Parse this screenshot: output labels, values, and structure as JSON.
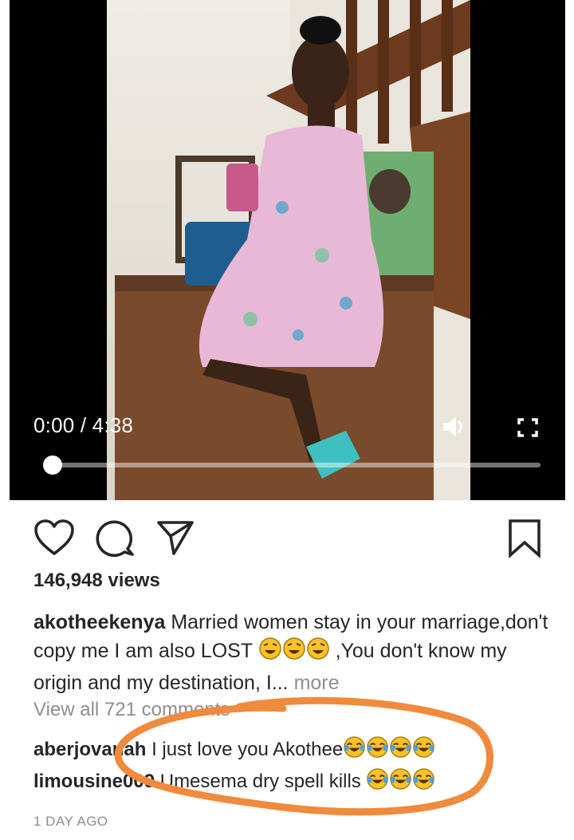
{
  "video": {
    "time_display": "0:00 / 4:38",
    "progress": 0.0
  },
  "actions": {
    "like_icon": "heart-icon",
    "comment_icon": "comment-icon",
    "share_icon": "send-icon",
    "save_icon": "bookmark-icon"
  },
  "post": {
    "views": "146,948 views",
    "username": "akotheekenya",
    "caption_part1": "Married women stay in your marriage,don't copy me I am also LOST",
    "caption_part2": ",You don't know my origin and my destination, I...",
    "more_label": "more",
    "view_all_comments": "View all 721 comments",
    "date": "1 DAY AGO"
  },
  "comments": [
    {
      "username": "aberjovanah",
      "text": "I just love you Akothee"
    },
    {
      "username": "limousine009",
      "text": "Umesema dry spell kills"
    }
  ],
  "colors": {
    "annotation_circle": "#f08a3c",
    "muted_text": "#8e8e8e",
    "text": "#262626"
  }
}
